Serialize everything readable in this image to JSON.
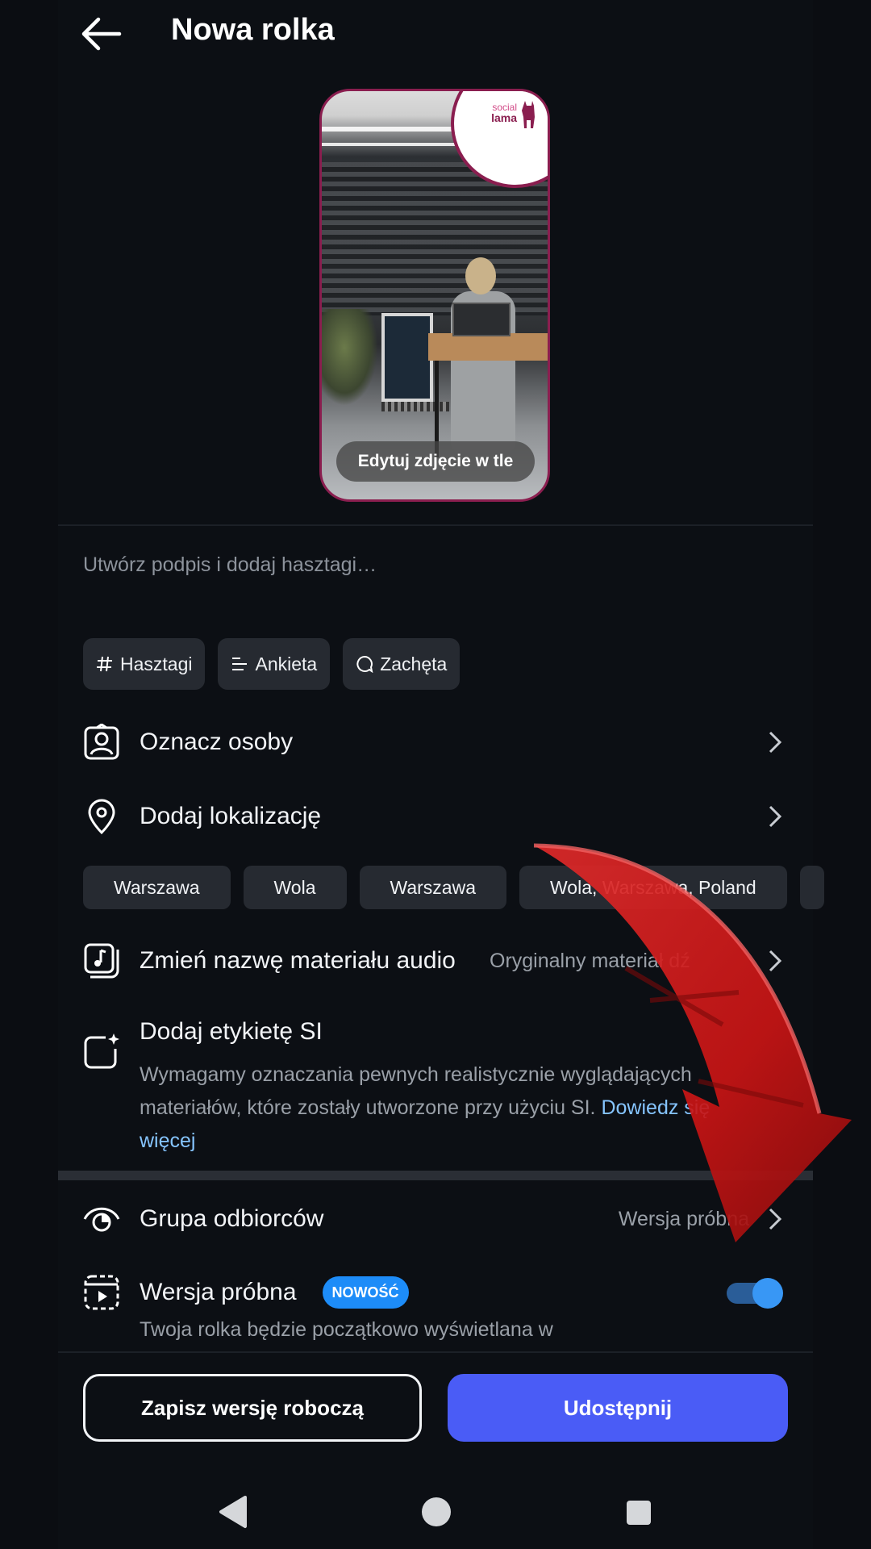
{
  "header": {
    "title": "Nowa rolka"
  },
  "thumbnail": {
    "edit_label": "Edytuj zdjęcie w tle",
    "logo_top": "social",
    "logo_bottom": "lama",
    "brand_color": "#8a1e4f"
  },
  "caption": {
    "placeholder": "Utwórz podpis i dodaj hasztagi…"
  },
  "chips": [
    {
      "label": "Hasztagi",
      "icon": "hash-icon"
    },
    {
      "label": "Ankieta",
      "icon": "list-icon"
    },
    {
      "label": "Zachęta",
      "icon": "speech-bubble-icon"
    }
  ],
  "rows": {
    "tag_people": {
      "label": "Oznacz osoby",
      "icon": "tag-person-icon"
    },
    "add_location": {
      "label": "Dodaj lokalizację",
      "icon": "location-pin-icon"
    },
    "rename_audio": {
      "label": "Zmień nazwę materiału audio",
      "value": "Oryginalny materiał dź",
      "icon": "audio-file-icon"
    },
    "audience": {
      "label": "Grupa odbiorców",
      "value": "Wersja próbna",
      "icon": "eye-icon"
    },
    "trial": {
      "label": "Wersja próbna",
      "badge": "NOWOŚĆ",
      "description": "Twoja rolka będzie początkowo wyświetlana w",
      "toggle_on": true,
      "icon": "reel-icon"
    }
  },
  "location_suggestions": [
    "Warszawa",
    "Wola",
    "Warszawa",
    "Wola, Warszawa, Poland"
  ],
  "ai_label": {
    "title": "Dodaj etykietę SI",
    "description": "Wymagamy oznaczania pewnych realistycznie wyglądających materiałów, które zostały utworzone przy użyciu SI.",
    "link": "Dowiedz się więcej",
    "icon": "ai-sparkle-icon"
  },
  "actions": {
    "draft_label": "Zapisz wersję roboczą",
    "share_label": "Udostępnij",
    "share_color": "#4a5cf6"
  },
  "colors": {
    "background": "#0c0f14",
    "chip_bg": "#262a31",
    "link": "#86c5ff",
    "toggle_accent": "#3897f5",
    "annotation_arrow": "#d01818"
  }
}
